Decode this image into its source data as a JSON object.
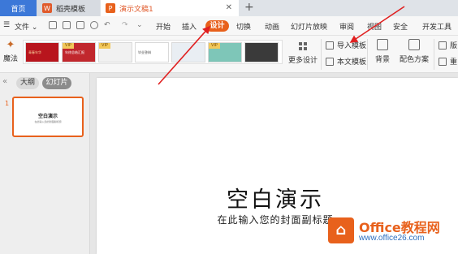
{
  "titlebar": {
    "tabs": [
      {
        "label": "首页"
      },
      {
        "label": "稻壳模板",
        "logo": "W"
      },
      {
        "label": "演示文稿1",
        "logo": "P"
      }
    ],
    "add_icon": "+"
  },
  "menubar": {
    "file_label": "文件",
    "items": [
      "开始",
      "插入",
      "设计",
      "切换",
      "动画",
      "幻灯片放映",
      "审阅",
      "视图",
      "安全",
      "开发工具"
    ],
    "active": "设计"
  },
  "ribbon": {
    "magic_label": "魔法",
    "vip_badge": "VIP",
    "templates": [
      {
        "text": "青春年华",
        "bg": "#b8151d",
        "fg": "#f9d9a2",
        "vip": false
      },
      {
        "text": "年终总结汇报",
        "bg": "#c1272d",
        "fg": "#ffffff",
        "vip": true
      },
      {
        "text": "",
        "bg": "#f1f1f1",
        "fg": "#888888",
        "vip": true
      },
      {
        "text": "毕业答辩",
        "bg": "#ffffff",
        "fg": "#444444",
        "vip": false
      },
      {
        "text": "",
        "bg": "#e9eef3",
        "fg": "#334455",
        "vip": false
      },
      {
        "text": "",
        "bg": "#7ec6b8",
        "fg": "#ffffff",
        "vip": true
      },
      {
        "text": "",
        "bg": "#3a3a3a",
        "fg": "#dddddd",
        "vip": false
      }
    ],
    "more_design_label": "更多设计",
    "import_template_label": "导入模板",
    "text_template_label": "本文模板",
    "background_label": "背景",
    "color_scheme_label": "配色方案",
    "edit_label": "版",
    "reset_label": "重"
  },
  "leftpane": {
    "outline_tab": "大纲",
    "slides_tab": "幻灯片",
    "slide_number": "1",
    "thumb_title": "空白演示",
    "thumb_subtitle": "在此输入您的封面副标题"
  },
  "slide": {
    "title": "空白演示",
    "subtitle": "在此输入您的封面副标题"
  },
  "watermark": {
    "brand": "Office教程网",
    "url": "www.office26.com"
  },
  "colors": {
    "accent": "#e8611c",
    "home_tab": "#3c78d8",
    "annotation_arrow": "#e02020"
  }
}
